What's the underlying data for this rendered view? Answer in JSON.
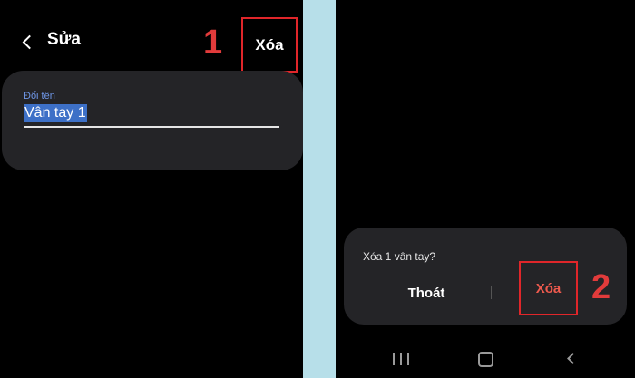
{
  "left_screen": {
    "title": "Sửa",
    "delete_button": "Xóa",
    "step_label": "1",
    "field": {
      "label": "Đổi tên",
      "value": "Vân tay 1"
    },
    "annotation_color": "#e0262a"
  },
  "right_screen": {
    "dialog": {
      "message": "Xóa 1 vân tay?",
      "cancel_button": "Thoát",
      "delete_button": "Xóa",
      "delete_color": "#ef5a4e"
    },
    "step_label": "2",
    "nav_bar": {
      "recents_icon": "recents-icon",
      "home_icon": "home-icon",
      "back_icon": "back-icon"
    }
  },
  "divider_color": "#b7dfe9"
}
